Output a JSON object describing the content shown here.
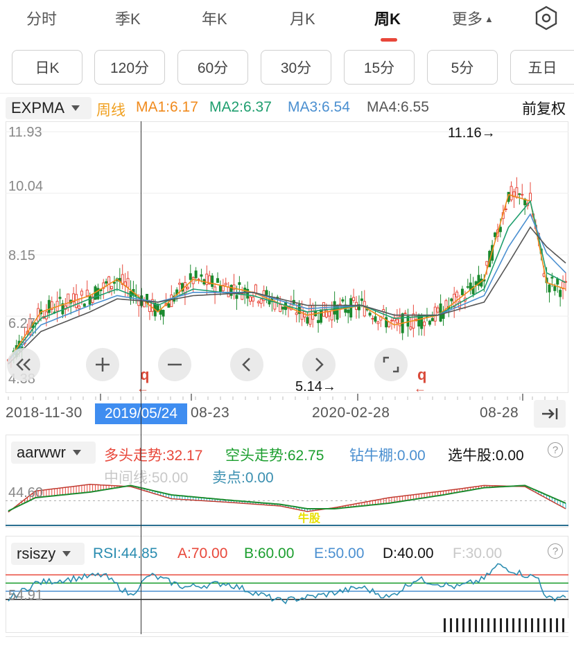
{
  "tabs": [
    "分时",
    "季K",
    "年K",
    "月K",
    "周K",
    "更多"
  ],
  "active_tab": "周K",
  "more_arrow": "▲",
  "periods": [
    "日K",
    "120分",
    "60分",
    "30分",
    "15分",
    "5分",
    "五日"
  ],
  "main_indicator": {
    "name": "EXPMA",
    "period_label": "周线",
    "ma1": "MA1:6.17",
    "ma2": "MA2:6.37",
    "ma3": "MA3:6.54",
    "ma4": "MA4:6.55",
    "adjust": "前复权",
    "price_ticks": [
      "11.93",
      "10.04",
      "8.15",
      "6.27",
      "4.38"
    ],
    "high_marker": "11.16→",
    "low_marker": "5.14→",
    "q_marker": "q"
  },
  "colors": {
    "up": "#e8473a",
    "down": "#1b8a2e",
    "ma1": "#f08a1c",
    "ma2": "#1e9e6e",
    "ma3": "#4a8fd0",
    "ma4": "#555555",
    "accent": "#3f8df0"
  },
  "dates": {
    "d1": "2018-11-30",
    "selected": "2019/05/24",
    "d2": "08-23",
    "d3": "2020-02-28",
    "d4": "08-28"
  },
  "aarwwr": {
    "name": "aarwwr",
    "bull": "多头走势:32.17",
    "bear": "空头走势:62.75",
    "drill": "钻牛棚:0.00",
    "pick": "选牛股:0.00",
    "mid": "中间线:50.00",
    "sell": "卖点:0.00",
    "level": "44.60",
    "tag": "牛股"
  },
  "rsiszy": {
    "name": "rsiszy",
    "rsi": "RSI:44.85",
    "a": "A:70.00",
    "b": "B:60.00",
    "e": "E:50.00",
    "d": "D:40.00",
    "f": "F:30.00",
    "level": "54.91"
  },
  "help_icon": "?",
  "icons": {
    "collapse": "collapse-left-icon",
    "zoom_in": "zoom-in-icon",
    "zoom_out": "zoom-out-icon",
    "prev": "chevron-left-icon",
    "next": "chevron-right-icon",
    "fullscreen": "fullscreen-icon",
    "jump_end": "jump-to-end-icon",
    "settings": "settings-hexagon-icon"
  },
  "chart_data": {
    "type": "candlestick",
    "y_range": [
      4.38,
      11.93
    ],
    "high": 11.16,
    "low": 5.14,
    "series": [
      {
        "name": "MA1",
        "value": 6.17
      },
      {
        "name": "MA2",
        "value": 6.37
      },
      {
        "name": "MA3",
        "value": 6.54
      },
      {
        "name": "MA4",
        "value": 6.55
      }
    ],
    "ma_paths": {
      "MA1": [
        [
          0,
          4.9
        ],
        [
          12,
          6.4
        ],
        [
          30,
          6.9
        ],
        [
          40,
          7.4
        ],
        [
          55,
          6.4
        ],
        [
          68,
          7.4
        ],
        [
          90,
          7.0
        ],
        [
          110,
          6.3
        ],
        [
          130,
          6.6
        ],
        [
          142,
          6.0
        ],
        [
          158,
          6.3
        ],
        [
          175,
          7.4
        ],
        [
          184,
          10.0
        ],
        [
          192,
          9.8
        ],
        [
          198,
          7.3
        ],
        [
          205,
          7.1
        ]
      ],
      "MA2": [
        [
          0,
          4.9
        ],
        [
          12,
          6.2
        ],
        [
          30,
          6.8
        ],
        [
          40,
          7.1
        ],
        [
          55,
          6.6
        ],
        [
          68,
          7.1
        ],
        [
          90,
          6.9
        ],
        [
          110,
          6.4
        ],
        [
          130,
          6.6
        ],
        [
          142,
          6.2
        ],
        [
          158,
          6.3
        ],
        [
          175,
          7.1
        ],
        [
          184,
          9.0
        ],
        [
          192,
          9.8
        ],
        [
          198,
          7.6
        ],
        [
          205,
          7.3
        ]
      ],
      "MA3": [
        [
          0,
          4.9
        ],
        [
          12,
          6.0
        ],
        [
          30,
          6.6
        ],
        [
          40,
          6.9
        ],
        [
          55,
          6.7
        ],
        [
          68,
          7.0
        ],
        [
          90,
          7.0
        ],
        [
          110,
          6.5
        ],
        [
          130,
          6.6
        ],
        [
          142,
          6.3
        ],
        [
          158,
          6.3
        ],
        [
          175,
          6.9
        ],
        [
          184,
          8.4
        ],
        [
          192,
          9.4
        ],
        [
          198,
          8.2
        ],
        [
          205,
          7.6
        ]
      ],
      "MA4": [
        [
          0,
          4.8
        ],
        [
          12,
          5.8
        ],
        [
          30,
          6.4
        ],
        [
          40,
          6.8
        ],
        [
          55,
          6.7
        ],
        [
          68,
          6.9
        ],
        [
          90,
          7.0
        ],
        [
          110,
          6.6
        ],
        [
          130,
          6.6
        ],
        [
          142,
          6.3
        ],
        [
          158,
          6.3
        ],
        [
          175,
          6.7
        ],
        [
          184,
          7.9
        ],
        [
          192,
          9.0
        ],
        [
          198,
          8.4
        ],
        [
          205,
          7.9
        ]
      ]
    },
    "aarwwr_indicator": {
      "bull": 32.17,
      "bear": 62.75,
      "mid": 50.0,
      "level": 44.6,
      "a_line": [
        [
          0,
          24
        ],
        [
          10,
          62
        ],
        [
          30,
          74
        ],
        [
          45,
          70
        ],
        [
          60,
          48
        ],
        [
          80,
          42
        ],
        [
          100,
          35
        ],
        [
          110,
          25
        ],
        [
          120,
          32
        ],
        [
          140,
          50
        ],
        [
          160,
          62
        ],
        [
          175,
          72
        ],
        [
          190,
          70
        ],
        [
          205,
          30
        ]
      ],
      "b_line": [
        [
          0,
          26
        ],
        [
          10,
          50
        ],
        [
          30,
          60
        ],
        [
          45,
          72
        ],
        [
          60,
          55
        ],
        [
          80,
          46
        ],
        [
          100,
          38
        ],
        [
          110,
          30
        ],
        [
          120,
          30
        ],
        [
          140,
          40
        ],
        [
          160,
          55
        ],
        [
          175,
          68
        ],
        [
          190,
          72
        ],
        [
          205,
          40
        ]
      ]
    },
    "rsiszy_indicator": {
      "rsi": 44.85,
      "a": 70,
      "b": 60,
      "e": 50,
      "d": 40,
      "f": 30,
      "level": 54.91,
      "rsi_line": [
        [
          0,
          40
        ],
        [
          10,
          60
        ],
        [
          35,
          70
        ],
        [
          45,
          45
        ],
        [
          52,
          70
        ],
        [
          65,
          55
        ],
        [
          80,
          60
        ],
        [
          100,
          38
        ],
        [
          115,
          45
        ],
        [
          130,
          55
        ],
        [
          140,
          42
        ],
        [
          150,
          65
        ],
        [
          165,
          55
        ],
        [
          175,
          65
        ],
        [
          180,
          82
        ],
        [
          190,
          70
        ],
        [
          195,
          66
        ],
        [
          198,
          40
        ],
        [
          205,
          45
        ]
      ]
    }
  }
}
